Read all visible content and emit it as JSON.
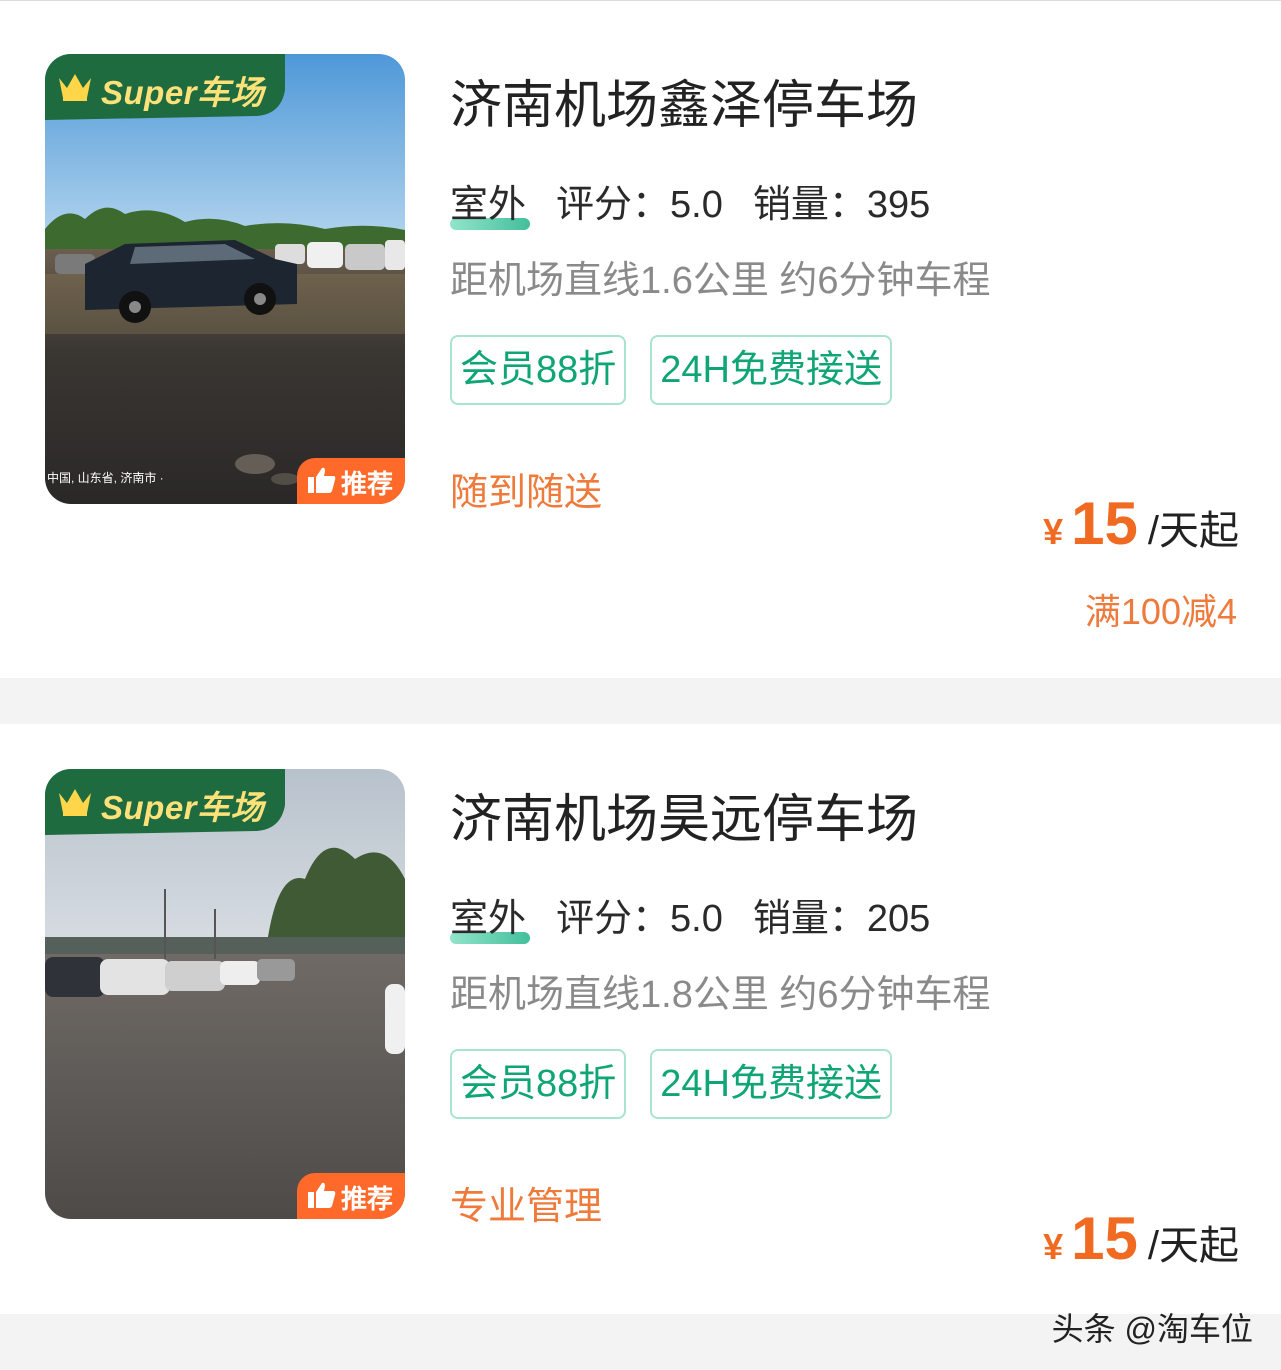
{
  "colors": {
    "accent_green": "#0fa574",
    "tag_border": "#a8e4cf",
    "price_orange": "#f06a22",
    "slogan_orange": "#ee7a3b",
    "badge_green": "#1d6b3e",
    "recommend_orange": "#ff6a2a",
    "separator": "#f3f3f3"
  },
  "listings": [
    {
      "badge": "Super车场",
      "recommend_label": "推荐",
      "photo_caption": "中国, 山东省, 济南市 ·",
      "title": "济南机场鑫泽停车场",
      "type": "室外",
      "rating": "评分：5.0",
      "sales": "销量：395",
      "distance": "距机场直线1.6公里 约6分钟车程",
      "tags": [
        "会员88折",
        "24H免费接送"
      ],
      "slogan": "随到随送",
      "currency": "¥",
      "price": "15",
      "unit": "/天起",
      "promo": "满100减4"
    },
    {
      "badge": "Super车场",
      "recommend_label": "推荐",
      "title": "济南机场昊远停车场",
      "type": "室外",
      "rating": "评分：5.0",
      "sales": "销量：205",
      "distance": "距机场直线1.8公里 约6分钟车程",
      "tags": [
        "会员88折",
        "24H免费接送"
      ],
      "slogan": "专业管理",
      "currency": "¥",
      "price": "15",
      "unit": "/天起"
    }
  ],
  "watermark": "头条 @淘车位",
  "icons": [
    "crown-icon",
    "thumbs-up-icon"
  ]
}
